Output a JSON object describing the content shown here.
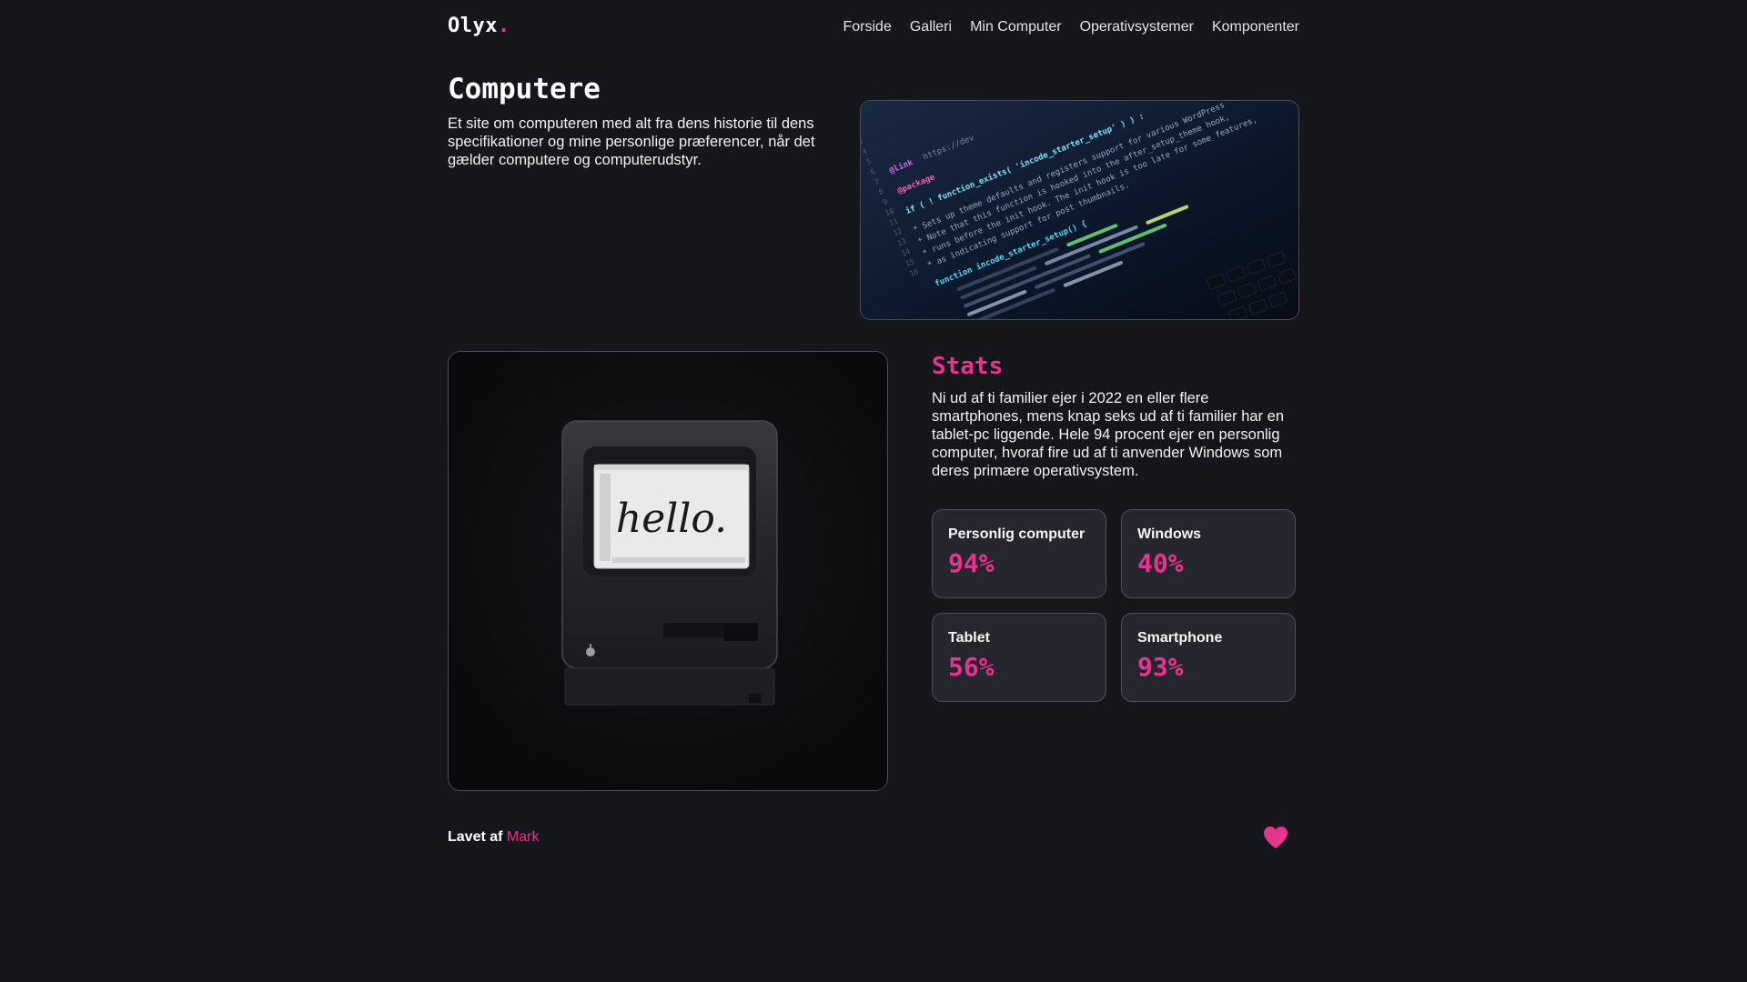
{
  "header": {
    "logo_text": "Olyx",
    "logo_dot": ".",
    "nav": [
      {
        "label": "Forside"
      },
      {
        "label": "Galleri"
      },
      {
        "label": "Min Computer"
      },
      {
        "label": "Operativsystemer"
      },
      {
        "label": "Komponenter"
      }
    ]
  },
  "hero": {
    "title": "Computere",
    "text": "Et site om computeren med alt fra dens historie til dens specifikationer og mine personlige præferencer, når det gælder computere og computerudstyr.",
    "image_code": {
      "url": "https://dev",
      "link": "@link",
      "package": "@package",
      "fn_line": "if ( ! function_exists( 'incode_starter_setup' ) ) :",
      "comment1": "* Sets up theme defaults and registers support for various WordPress",
      "comment2": "* Note that this function is hooked into the after_setup_theme hook,",
      "comment3": "* runs before the init hook. The init hook is too late for some features,",
      "comment4": "* as indicating support for post thumbnails.",
      "fn_decl": "function incode_starter_setup() {"
    }
  },
  "showcase": {
    "screen_text": "hello."
  },
  "stats": {
    "title": "Stats",
    "text": "Ni ud af ti familier ejer i 2022 en eller flere smartphones, mens knap seks ud af ti familier har en tablet-pc liggende. Hele 94 procent ejer en personlig computer, hvoraf fire ud af ti anvender Windows som deres primære operativsystem.",
    "cards": [
      {
        "label": "Personlig computer",
        "value": "94%"
      },
      {
        "label": "Windows",
        "value": "40%"
      },
      {
        "label": "Tablet",
        "value": "56%"
      },
      {
        "label": "Smartphone",
        "value": "93%"
      }
    ]
  },
  "footer": {
    "prefix": "Lavet af",
    "author": "Mark",
    "icon": "heart-icon"
  },
  "colors": {
    "background": "#16171c",
    "accent": "#e8338f",
    "card": "#26272e"
  }
}
